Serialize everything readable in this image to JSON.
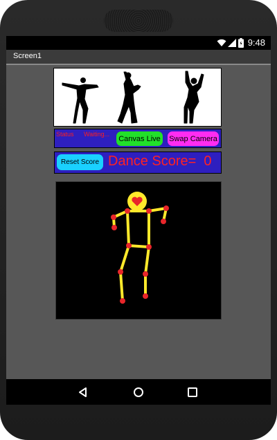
{
  "status_bar": {
    "time": "9:48"
  },
  "app": {
    "title": "Screen1"
  },
  "status": {
    "label": "Status",
    "value": "Waiting..."
  },
  "buttons": {
    "canvas_live": "Canvas Live",
    "swap_camera": "Swap Camera",
    "reset_score": "Reset Score"
  },
  "score": {
    "label": "Dance Score=",
    "value": "0"
  },
  "colors": {
    "panel_blue": "#2e1fbf",
    "red_text": "#ff2222",
    "canvas_live_green": "#22e02a",
    "swap_camera_magenta": "#ff2cf2",
    "reset_cyan": "#1ad1ff",
    "skeleton_yellow": "#ffe92b",
    "joint_red": "#e8262a"
  },
  "icons": {
    "status_icons": [
      "wifi-icon",
      "signal-icon",
      "battery-icon"
    ],
    "nav": [
      "back-icon",
      "home-icon",
      "recents-icon"
    ]
  }
}
